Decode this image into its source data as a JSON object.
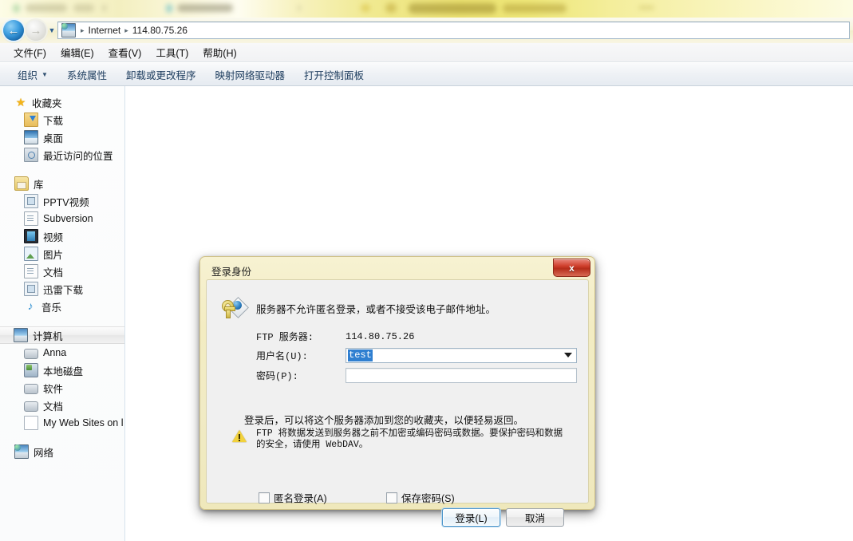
{
  "window": {
    "address_bar": {
      "back_icon": "back-arrow-icon",
      "forward_icon": "forward-arrow-icon",
      "history_icon": "chevron-down-icon",
      "location_icon": "network-computer-icon",
      "crumbs": [
        "Internet",
        "114.80.75.26"
      ],
      "separator": "▸"
    },
    "menu_bar": [
      "文件(F)",
      "编辑(E)",
      "查看(V)",
      "工具(T)",
      "帮助(H)"
    ],
    "command_bar": {
      "organize_label": "组织",
      "organize_caret": "▼",
      "items": [
        "系统属性",
        "卸载或更改程序",
        "映射网络驱动器",
        "打开控制面板"
      ]
    }
  },
  "sidebar": {
    "groups": [
      {
        "header": {
          "label": "收藏夹",
          "icon": "star-icon"
        },
        "items": [
          {
            "label": "下载",
            "icon": "download-folder-icon"
          },
          {
            "label": "桌面",
            "icon": "desktop-icon"
          },
          {
            "label": "最近访问的位置",
            "icon": "recent-places-icon"
          }
        ]
      },
      {
        "header": {
          "label": "库",
          "icon": "library-icon"
        },
        "items": [
          {
            "label": "PPTV视频",
            "icon": "stack-icon"
          },
          {
            "label": "Subversion",
            "icon": "document-icon"
          },
          {
            "label": "视频",
            "icon": "film-icon"
          },
          {
            "label": "图片",
            "icon": "picture-icon"
          },
          {
            "label": "文档",
            "icon": "document-icon"
          },
          {
            "label": "迅雷下载",
            "icon": "stack-icon"
          },
          {
            "label": "音乐",
            "icon": "music-note-icon"
          }
        ]
      },
      {
        "header": {
          "label": "计算机",
          "icon": "computer-icon",
          "selected": true
        },
        "items": [
          {
            "label": "Anna",
            "icon": "drive-icon"
          },
          {
            "label": "本地磁盘",
            "icon": "local-disk-icon"
          },
          {
            "label": "软件",
            "icon": "drive-icon"
          },
          {
            "label": "文档",
            "icon": "drive-icon"
          },
          {
            "label": "My Web Sites on l",
            "icon": "page-icon"
          }
        ]
      },
      {
        "header": {
          "label": "网络",
          "icon": "network-icon"
        },
        "items": []
      }
    ]
  },
  "dialog": {
    "title": "登录身份",
    "close_label": "x",
    "key_icon": "key-globe-icon",
    "message": "服务器不允许匿名登录，或者不接受该电子邮件地址。",
    "server_label": "FTP 服务器:",
    "server_value": "114.80.75.26",
    "username_label": "用户名(U):",
    "username_value": "test",
    "username_caret_icon": "chevron-down-icon",
    "password_label": "密码(P):",
    "password_value": "",
    "hint": "登录后，可以将这个服务器添加到您的收藏夹，以便轻易返回。",
    "warning_icon": "warning-triangle-icon",
    "warning_line1": "FTP 将数据发送到服务器之前不加密或编码密码或数据。要保护密码和数据",
    "warning_line2": "的安全，请使用 WebDAV。",
    "anonymous_label": "匿名登录(A)",
    "anonymous_checked": false,
    "save_password_label": "保存密码(S)",
    "save_password_checked": false,
    "login_button": "登录(L)",
    "cancel_button": "取消"
  },
  "colors": {
    "dialog_frame": "#f3ecc2",
    "dialog_body": "#f0f0f0",
    "close_button": "#cf3f2c",
    "selection_blue": "#2f7fd1",
    "focus_ring": "#4a93c9",
    "warning_yellow": "#f2d23c"
  }
}
